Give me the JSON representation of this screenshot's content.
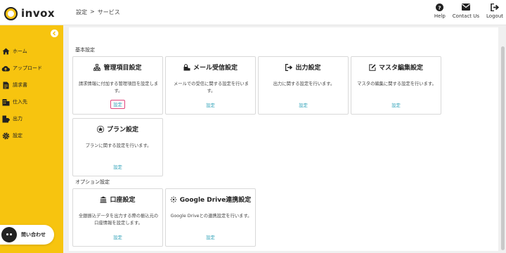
{
  "header": {
    "logo_text": "invox",
    "breadcrumb": [
      "設定",
      ">",
      "サービス"
    ],
    "actions": [
      {
        "name": "help-button",
        "icon": "question-circle-icon",
        "label": "Help"
      },
      {
        "name": "contact-button",
        "icon": "envelope-icon",
        "label": "Contact Us"
      },
      {
        "name": "logout-button",
        "icon": "sign-out-icon",
        "label": "Logout"
      }
    ]
  },
  "sidebar": {
    "items": [
      {
        "icon": "home-icon",
        "label": "ホーム"
      },
      {
        "icon": "cloud-upload-icon",
        "label": "アップロード"
      },
      {
        "icon": "document-icon",
        "label": "請求書"
      },
      {
        "icon": "building-icon",
        "label": "仕入先"
      },
      {
        "icon": "export-icon",
        "label": "出力"
      },
      {
        "icon": "gear-icon",
        "label": "設定"
      }
    ],
    "chat_label": "問い合わせ"
  },
  "sections": {
    "basic": {
      "title": "基本設定",
      "cards": [
        {
          "icon": "sitemap-icon",
          "title": "管理項目設定",
          "desc": "請求情報に付加する管理項目を設定しま\nす。",
          "link": "設定"
        },
        {
          "icon": "mail-lock-icon",
          "title": "メール受信設定",
          "desc": "メールでの受信に関する設定を行いま\nす。",
          "link": "設定"
        },
        {
          "icon": "sign-out-icon",
          "title": "出力設定",
          "desc": "出力に関する設定を行います。",
          "link": "設定"
        },
        {
          "icon": "edit-icon",
          "title": "マスタ編集設定",
          "desc": "マスタの編集に関する設定を行います。",
          "link": "設定"
        },
        {
          "icon": "star-icon",
          "title": "プラン設定",
          "desc": "プランに関する設定を行います。",
          "link": "設定"
        }
      ]
    },
    "options": {
      "title": "オプション設定",
      "cards": [
        {
          "icon": "bank-icon",
          "title": "口座設定",
          "desc": "全銀振込データを出力する際の振込元の\n口座情報を設定します。",
          "link": "設定"
        },
        {
          "icon": "google-drive-icon",
          "title": "Google Drive連携設定",
          "desc": "Google Driveとの連携設定を行います。",
          "link": "設定"
        }
      ]
    }
  },
  "colors": {
    "accent": "#f7c40f",
    "link": "#2a9fb6",
    "highlight": "#e0467c"
  }
}
